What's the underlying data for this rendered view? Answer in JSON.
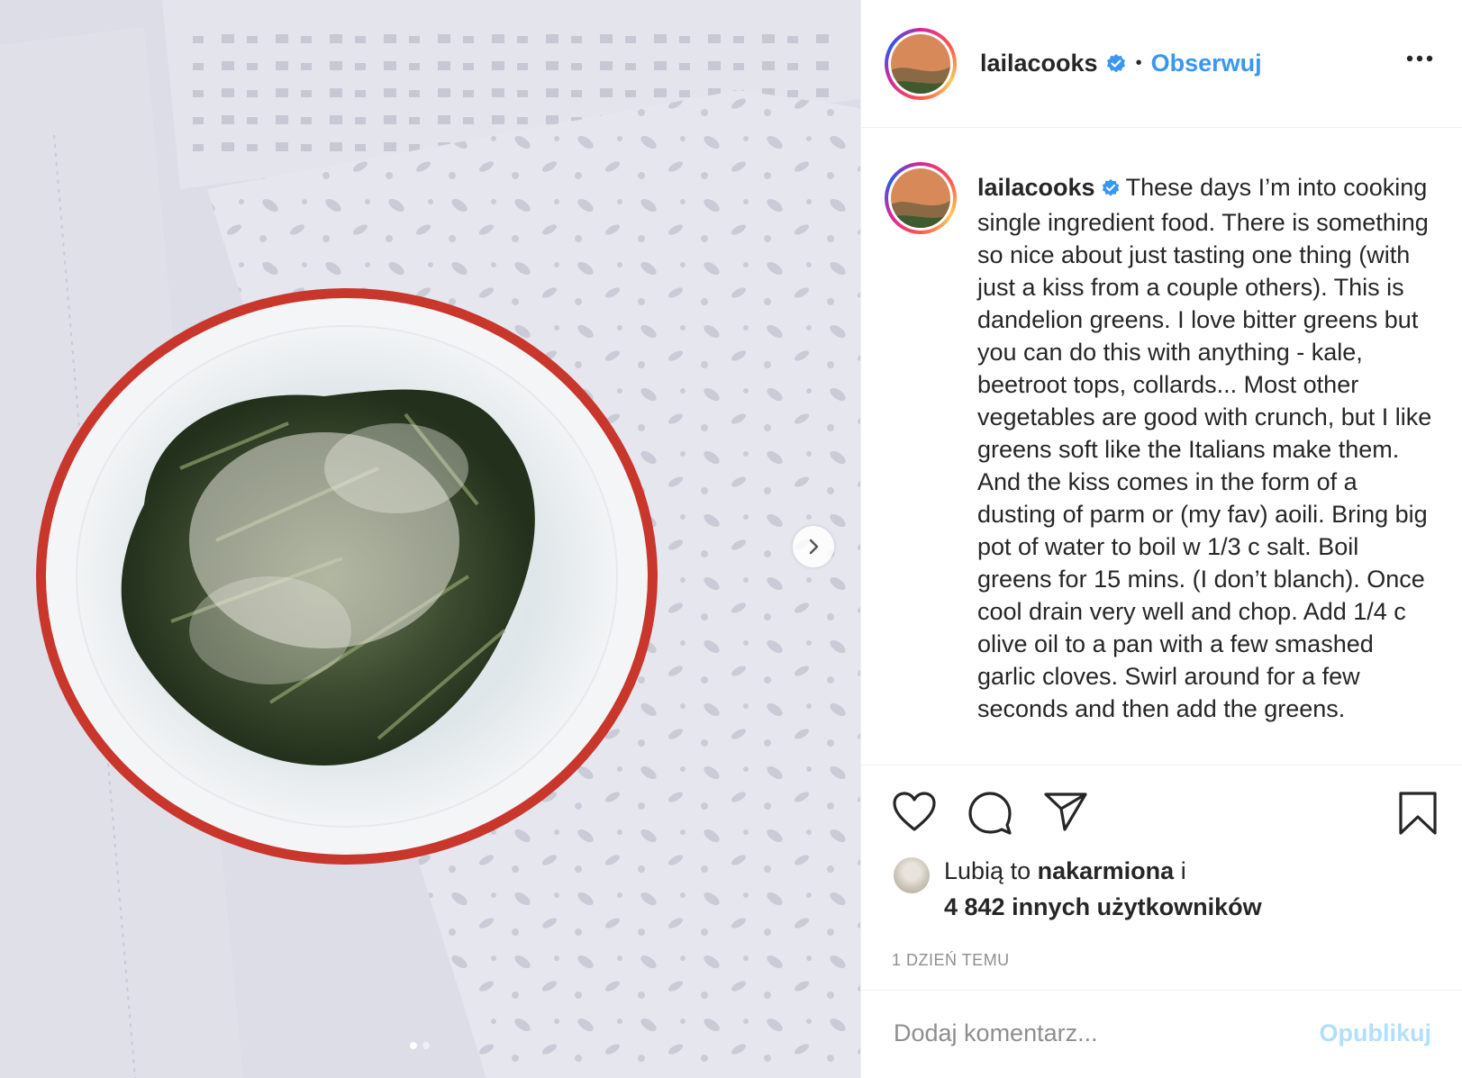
{
  "header": {
    "username": "lailacooks",
    "separator": "•",
    "follow_label": "Obserwuj",
    "more_icon": "more-horizontal-icon"
  },
  "caption": {
    "username": "lailacooks",
    "text": "These days I’m into cooking single ingredient food. There is something so nice about just tasting one thing (with just a kiss from a couple others). This is dandelion greens. I love bitter greens but you can do this with anything - kale, beetroot tops, collards... Most other vegetables are good with crunch, but I like greens soft like the Italians make them. And the kiss comes in the form of a dusting of parm or (my fav) aoili. Bring big pot of water to boil w 1/3 c salt. Boil greens for 15 mins. (I don’t blanch). Once cool drain very well and chop. Add 1/4 c olive oil to a pan with a few smashed garlic cloves. Swirl around for a few seconds and then add the greens."
  },
  "actions": {
    "icons": [
      "heart-icon",
      "comment-icon",
      "share-icon",
      "bookmark-icon"
    ]
  },
  "likes": {
    "prefix": "Lubią to",
    "liked_by": "nakarmiona",
    "suffix": "i",
    "others": "4 842 innych użytkowników"
  },
  "timestamp": "1 DZIEŃ TEMU",
  "comment": {
    "placeholder": "Dodaj komentarz...",
    "publish_label": "Opublikuj"
  },
  "carousel": {
    "slide": 1,
    "total": 2
  },
  "colors": {
    "link": "#3897f0",
    "publish_disabled": "#b2dffc",
    "verified": "#3897f0",
    "plate_rim": "#c8362c"
  }
}
